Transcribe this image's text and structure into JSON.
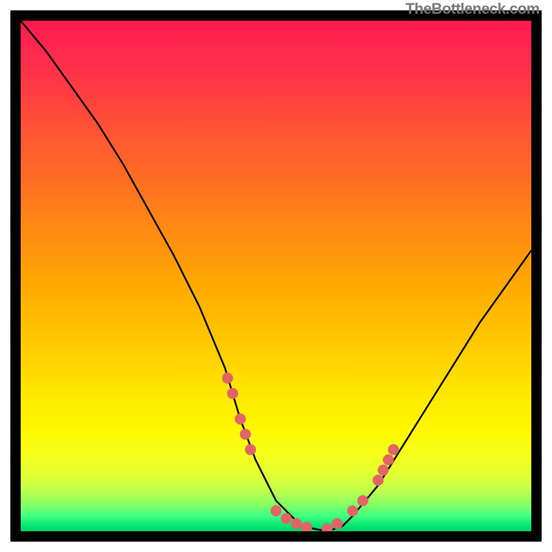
{
  "watermark": "TheBottleneck.com",
  "chart_data": {
    "type": "line",
    "title": "",
    "xlabel": "",
    "ylabel": "",
    "xlim": [
      0,
      100
    ],
    "ylim": [
      0,
      100
    ],
    "series": [
      {
        "name": "curve",
        "x": [
          0,
          5,
          10,
          15,
          20,
          25,
          30,
          35,
          40,
          43,
          46,
          50,
          55,
          60,
          63,
          65,
          70,
          75,
          80,
          85,
          90,
          95,
          100
        ],
        "y": [
          100,
          94,
          87,
          80,
          72,
          63,
          54,
          44,
          32,
          22,
          14,
          6,
          1,
          0,
          1,
          3,
          9,
          17,
          25,
          33,
          41,
          48,
          55
        ]
      }
    ],
    "annotations": {
      "dots_color": "#e06666",
      "dots": [
        {
          "x": 40.5,
          "y": 30
        },
        {
          "x": 41.5,
          "y": 27
        },
        {
          "x": 43,
          "y": 22
        },
        {
          "x": 44,
          "y": 19
        },
        {
          "x": 45,
          "y": 16
        },
        {
          "x": 50,
          "y": 4
        },
        {
          "x": 52,
          "y": 2.5
        },
        {
          "x": 54,
          "y": 1.5
        },
        {
          "x": 56,
          "y": 0.8
        },
        {
          "x": 60,
          "y": 0.5
        },
        {
          "x": 62,
          "y": 1.5
        },
        {
          "x": 65,
          "y": 4
        },
        {
          "x": 67,
          "y": 6
        },
        {
          "x": 70,
          "y": 10
        },
        {
          "x": 71,
          "y": 12
        },
        {
          "x": 72,
          "y": 14
        },
        {
          "x": 73,
          "y": 16
        }
      ]
    }
  }
}
